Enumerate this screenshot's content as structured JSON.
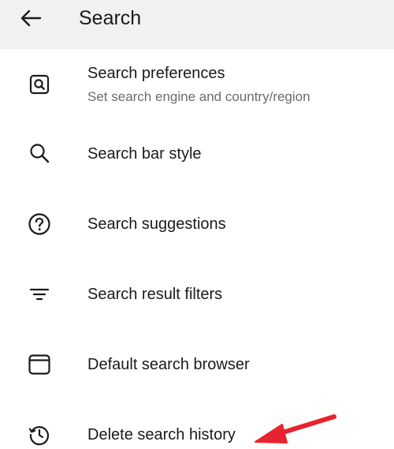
{
  "header": {
    "title": "Search",
    "back_icon": "arrow-left-icon"
  },
  "items": [
    {
      "label": "Search preferences",
      "sublabel": "Set search engine and country/region",
      "icon": "search-box-icon"
    },
    {
      "label": "Search bar style",
      "icon": "search-icon"
    },
    {
      "label": "Search suggestions",
      "icon": "question-circle-icon"
    },
    {
      "label": "Search result filters",
      "icon": "filter-lines-icon"
    },
    {
      "label": "Default search browser",
      "icon": "browser-window-icon"
    },
    {
      "label": "Delete search history",
      "icon": "history-icon"
    }
  ],
  "colors": {
    "header_bg": "#f1f1f1",
    "text": "#1a1a1a",
    "subtext": "#6b6b6b",
    "annotation": "#e8222e"
  }
}
